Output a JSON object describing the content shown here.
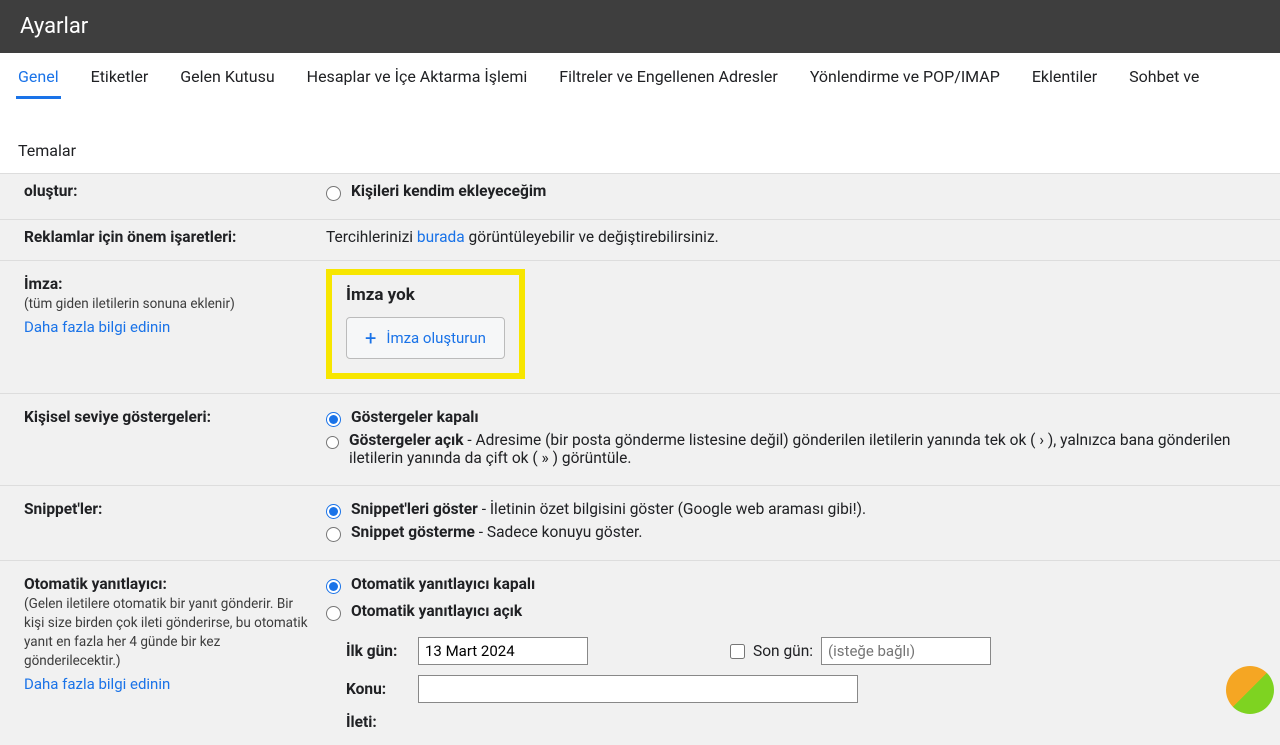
{
  "page_title": "Ayarlar",
  "tabs": {
    "genel": "Genel",
    "etiketler": "Etiketler",
    "gelen": "Gelen Kutusu",
    "hesaplar": "Hesaplar ve İçe Aktarma İşlemi",
    "filtreler": "Filtreler ve Engellenen Adresler",
    "yonlendirme": "Yönlendirme ve POP/IMAP",
    "eklentiler": "Eklentiler",
    "sohbet": "Sohbet ve",
    "temalar": "Temalar"
  },
  "contacts_create": {
    "label": "oluştur:",
    "opt_manual": "Kişileri kendim ekleyeceğim"
  },
  "ads": {
    "label": "Reklamlar için önem işaretleri:",
    "prefix": "Tercihlerinizi ",
    "link": "burada",
    "suffix": " görüntüleyebilir ve değiştirebilirsiniz."
  },
  "signature": {
    "label": "İmza:",
    "sub": "(tüm giden iletilerin sonuna eklenir)",
    "learn": "Daha fazla bilgi edinin",
    "none": "İmza yok",
    "create": "İmza oluşturun"
  },
  "indicators": {
    "label": "Kişisel seviye göstergeleri:",
    "off": "Göstergeler kapalı",
    "on_bold": "Göstergeler açık",
    "on_rest": " - Adresime (bir posta gönderme listesine değil) gönderilen iletilerin yanında tek ok ( › ), yalnızca bana gönderilen iletilerin yanında da çift ok ( » ) görüntüle."
  },
  "snippets": {
    "label": "Snippet'ler:",
    "show_bold": "Snippet'leri göster",
    "show_rest": " - İletinin özet bilgisini göster (Google web araması gibi!).",
    "hide_bold": "Snippet gösterme",
    "hide_rest": " - Sadece konuyu göster."
  },
  "autoresponder": {
    "label": "Otomatik yanıtlayıcı:",
    "sub": "(Gelen iletilere otomatik bir yanıt gönderir. Bir kişi size birden çok ileti gönderirse, bu otomatik yanıt en fazla her 4 günde bir kez gönderilecektir.)",
    "learn": "Daha fazla bilgi edinin",
    "off": "Otomatik yanıtlayıcı kapalı",
    "on": "Otomatik yanıtlayıcı açık",
    "first_day_label": "İlk gün:",
    "first_day_value": "13 Mart 2024",
    "last_day_label": "Son gün:",
    "last_day_placeholder": "(isteğe bağlı)",
    "subject_label": "Konu:",
    "message_label": "İleti:"
  }
}
